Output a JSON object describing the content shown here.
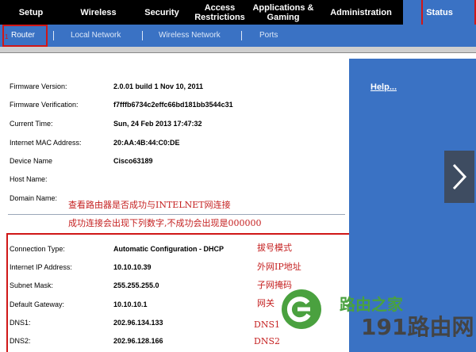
{
  "nav": {
    "setup": "Setup",
    "wireless": "Wireless",
    "security": "Security",
    "access": "Access\nRestrictions",
    "apps": "Applications &\nGaming",
    "admin": "Administration",
    "status": "Status"
  },
  "subnav": {
    "router": "Router",
    "local": "Local Network",
    "wnet": "Wireless Network",
    "ports": "Ports",
    "marker": "1"
  },
  "info": {
    "firmware_version": {
      "label": "Firmware Version:",
      "value": "2.0.01 build 1  Nov 10, 2011"
    },
    "firmware_verification": {
      "label": "Firmware Verification:",
      "value": "f7fffb6734c2effc66bd181bb3544c31"
    },
    "current_time": {
      "label": "Current Time:",
      "value": "Sun, 24 Feb 2013 17:47:32"
    },
    "mac": {
      "label": "Internet MAC Address:",
      "value": "20:AA:4B:44:C0:DE"
    },
    "device_name": {
      "label": "Device Name",
      "value": "Cisco63189"
    },
    "host_name": {
      "label": "Host Name:",
      "value": ""
    },
    "domain_name": {
      "label": "Domain Name:",
      "value": ""
    }
  },
  "notes": {
    "line1": "查看路由器是否成功与INTELNET网连接",
    "line2": "成功连接会出现下列数字,不成功会出现是000000",
    "conn_type": "拔号模式",
    "ip": "外网IP地址",
    "mask": "子网掩码",
    "gateway": "网关",
    "dns1": "DNS1",
    "dns2": "DNS2"
  },
  "connection": {
    "type": {
      "label": "Connection Type:",
      "value": "Automatic Configuration - DHCP"
    },
    "ip": {
      "label": "Internet IP Address:",
      "value": "10.10.10.39"
    },
    "mask": {
      "label": "Subnet Mask:",
      "value": "255.255.255.0"
    },
    "gateway": {
      "label": "Default Gateway:",
      "value": "10.10.10.1"
    },
    "dns1": {
      "label": "DNS1:",
      "value": "202.96.134.133"
    },
    "dns2": {
      "label": "DNS2:",
      "value": "202.96.128.166"
    }
  },
  "sidebar": {
    "help": "Help..."
  },
  "watermark": {
    "text1": "路由之家",
    "text2": "191路由网"
  },
  "colors": {
    "nav_bg": "#000000",
    "accent_blue": "#3a72c4",
    "annotation_red": "#d01717"
  },
  "icons": {
    "next": "chevron-right-icon",
    "logo": "watermark-logo"
  }
}
